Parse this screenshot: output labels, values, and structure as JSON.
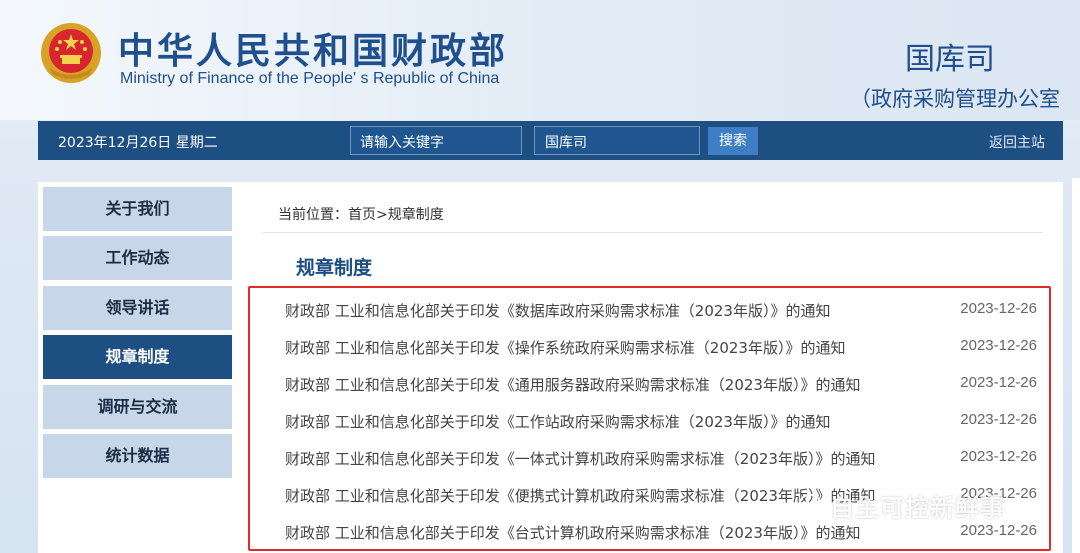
{
  "header": {
    "brand_cn": "中华人民共和国财政部",
    "brand_en": "Ministry of Finance of the People' s Republic of China",
    "dept_name": "国库司",
    "dept_sub": "（政府采购管理办公室"
  },
  "navbar": {
    "date": "2023年12月26日  星期二",
    "search_placeholder": "请输入关键字",
    "scope": "国库司",
    "search_button": "搜索",
    "home_link": "返回主站"
  },
  "sidebar": {
    "items": [
      {
        "label": "关于我们"
      },
      {
        "label": "工作动态"
      },
      {
        "label": "领导讲话"
      },
      {
        "label": "规章制度",
        "active": true
      },
      {
        "label": "调研与交流"
      },
      {
        "label": "统计数据"
      }
    ]
  },
  "main": {
    "breadcrumb": "当前位置：首页>规章制度",
    "section_title": "规章制度",
    "articles": [
      {
        "title": "财政部 工业和信息化部关于印发《数据库政府采购需求标准（2023年版）》的通知",
        "date": "2023-12-26"
      },
      {
        "title": "财政部 工业和信息化部关于印发《操作系统政府采购需求标准（2023年版）》的通知",
        "date": "2023-12-26"
      },
      {
        "title": "财政部 工业和信息化部关于印发《通用服务器政府采购需求标准（2023年版）》的通知",
        "date": "2023-12-26"
      },
      {
        "title": "财政部 工业和信息化部关于印发《工作站政府采购需求标准（2023年版）》的通知",
        "date": "2023-12-26"
      },
      {
        "title": "财政部 工业和信息化部关于印发《一体式计算机政府采购需求标准（2023年版）》的通知",
        "date": "2023-12-26"
      },
      {
        "title": "财政部 工业和信息化部关于印发《便携式计算机政府采购需求标准（2023年版）》的通知",
        "date": "2023-12-26"
      },
      {
        "title": "财政部 工业和信息化部关于印发《台式计算机政府采购需求标准（2023年版）》的通知",
        "date": "2023-12-26"
      }
    ]
  },
  "watermark": {
    "text": "自主可控新鲜事",
    "icon": "wechat-icon"
  },
  "colors": {
    "brand_blue": "#1d4f83",
    "highlight_red": "#e02b2b"
  }
}
